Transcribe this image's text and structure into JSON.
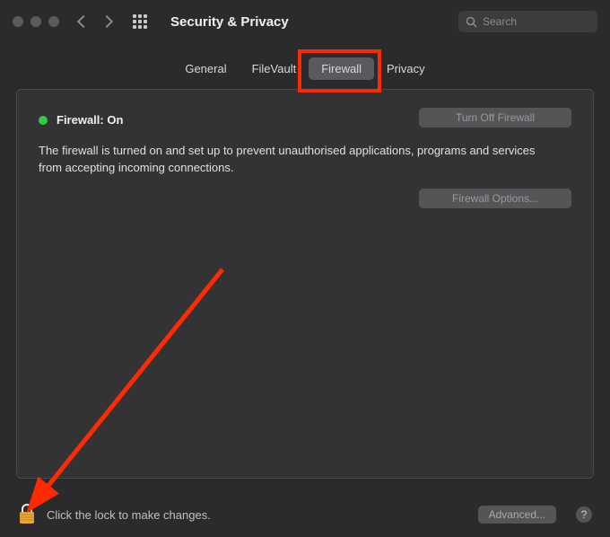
{
  "window": {
    "title": "Security & Privacy"
  },
  "search": {
    "placeholder": "Search"
  },
  "tabs": {
    "general": "General",
    "filevault": "FileVault",
    "firewall": "Firewall",
    "privacy": "Privacy"
  },
  "firewall": {
    "status_label": "Firewall: On",
    "turn_off_label": "Turn Off Firewall",
    "description": "The firewall is turned on and set up to prevent unauthorised applications, programs and services from accepting incoming connections.",
    "options_label": "Firewall Options..."
  },
  "footer": {
    "lock_text": "Click the lock to make changes.",
    "advanced_label": "Advanced...",
    "help_label": "?"
  }
}
